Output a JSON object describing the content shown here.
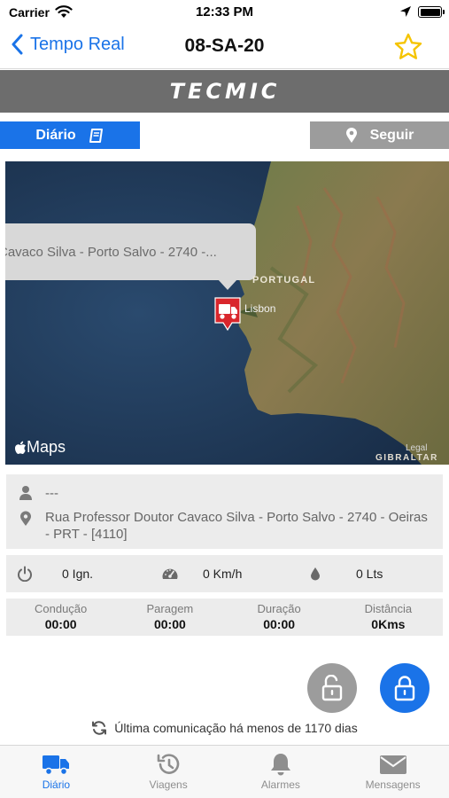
{
  "status_bar": {
    "carrier": "Carrier",
    "time": "12:33 PM"
  },
  "nav": {
    "back_label": "Tempo Real",
    "title": "08-SA-20"
  },
  "brand": {
    "logo_text": "TECMIC"
  },
  "actions": {
    "diario_label": "Diário",
    "seguir_label": "Seguir"
  },
  "map": {
    "callout_text": "Cavaco Silva - Porto Salvo - 2740 -...",
    "label_country": "PORTUGAL",
    "label_city": "Lisbon",
    "label_gibraltar": "GIBRALTAR",
    "legal_label": "Legal",
    "maps_logo": "Maps"
  },
  "vehicle": {
    "driver": "---",
    "address": "Rua Professor Doutor Cavaco Silva - Porto Salvo - 2740 - Oeiras - PRT - [4110]"
  },
  "stats": {
    "ignition": "0 Ign.",
    "speed": "0 Km/h",
    "fuel": "0 Lts"
  },
  "times": [
    {
      "label": "Condução",
      "value": "00:00"
    },
    {
      "label": "Paragem",
      "value": "00:00"
    },
    {
      "label": "Duração",
      "value": "00:00"
    },
    {
      "label": "Distância",
      "value": "0Kms"
    }
  ],
  "last_comm": "Última comunicação há menos de 1170 dias",
  "tabs": [
    {
      "label": "Diário",
      "icon": "truck-icon",
      "active": true
    },
    {
      "label": "Viagens",
      "icon": "history-icon",
      "active": false
    },
    {
      "label": "Alarmes",
      "icon": "bell-icon",
      "active": false
    },
    {
      "label": "Mensagens",
      "icon": "envelope-icon",
      "active": false
    }
  ],
  "colors": {
    "accent": "#1a73e8",
    "banner": "#6d6d6d",
    "marker": "#d9262c",
    "star": "#f5c400"
  }
}
